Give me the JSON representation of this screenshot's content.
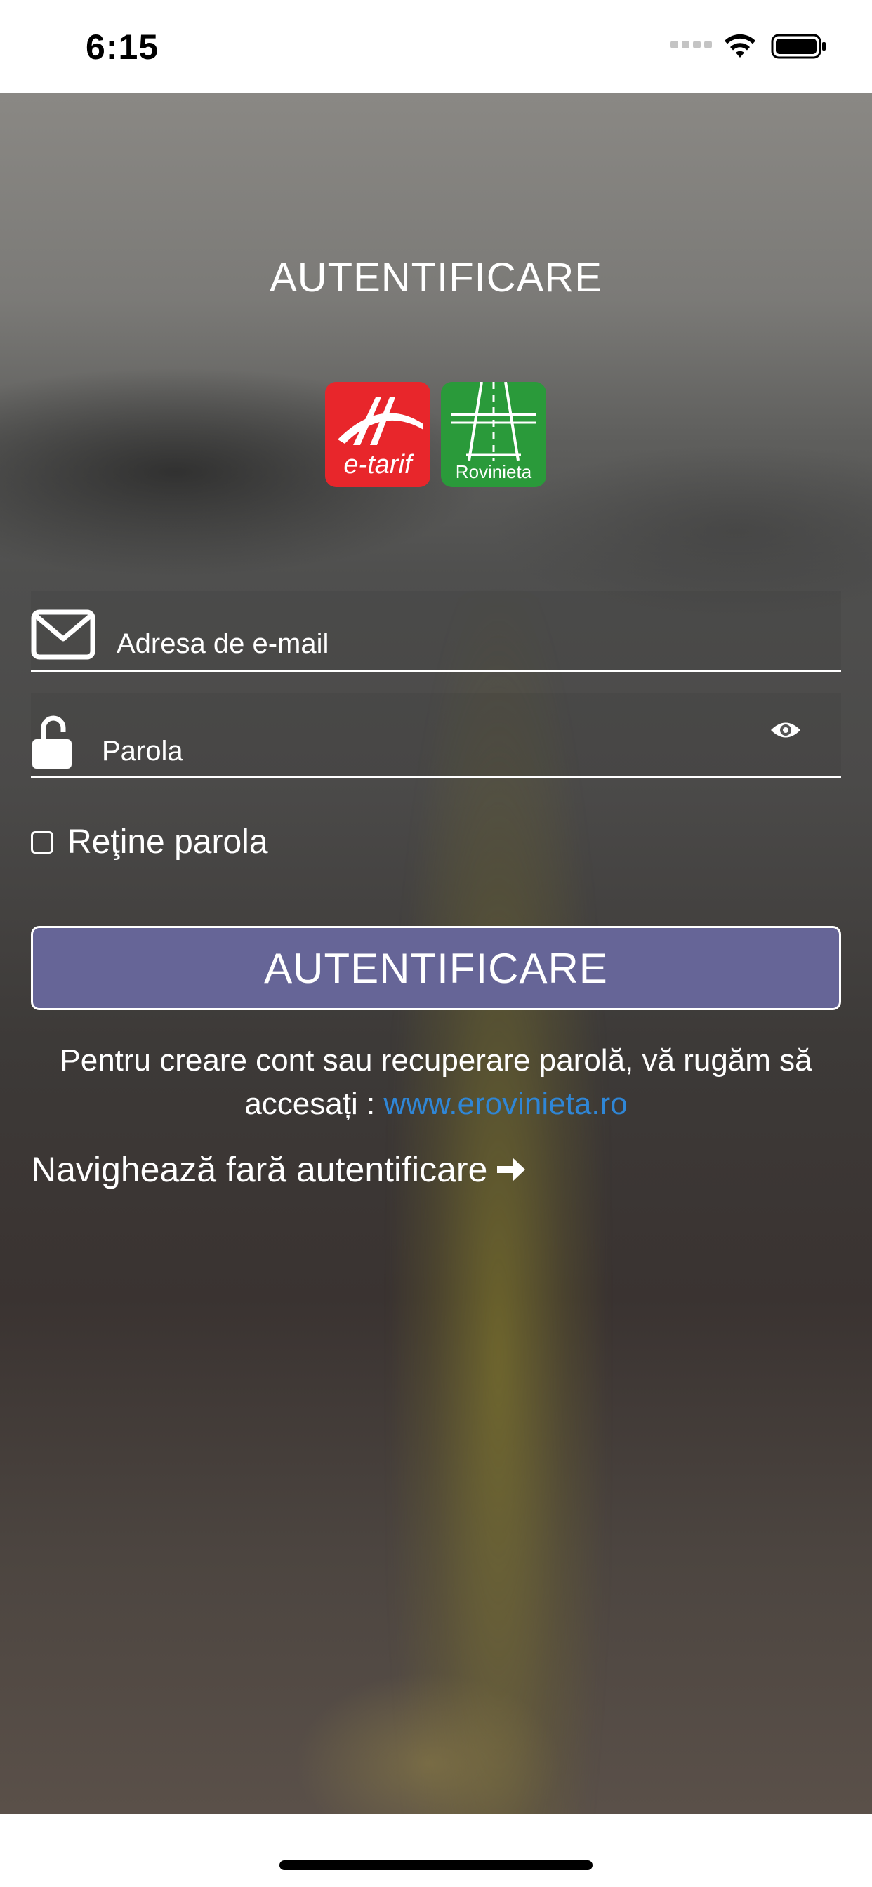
{
  "status_bar": {
    "time": "6:15"
  },
  "header": {
    "title": "AUTENTIFICARE"
  },
  "logos": {
    "etarif_label": "e-tarif",
    "rovinieta_label": "Rovinieta"
  },
  "form": {
    "email_placeholder": "Adresa de e-mail",
    "password_placeholder": "Parola",
    "remember_label": "Reţine parola",
    "remember_checked": false,
    "submit_label": "AUTENTIFICARE"
  },
  "info": {
    "text": "Pentru creare cont sau recuperare parolă, vă rugăm să accesați : ",
    "link_text": "www.erovinieta.ro"
  },
  "guest": {
    "label": "Navighează fară autentificare"
  },
  "colors": {
    "button_bg": "#666597",
    "link": "#2f86d6",
    "etarif_red": "#e8262b",
    "rovinieta_green": "#2a9a3a"
  }
}
